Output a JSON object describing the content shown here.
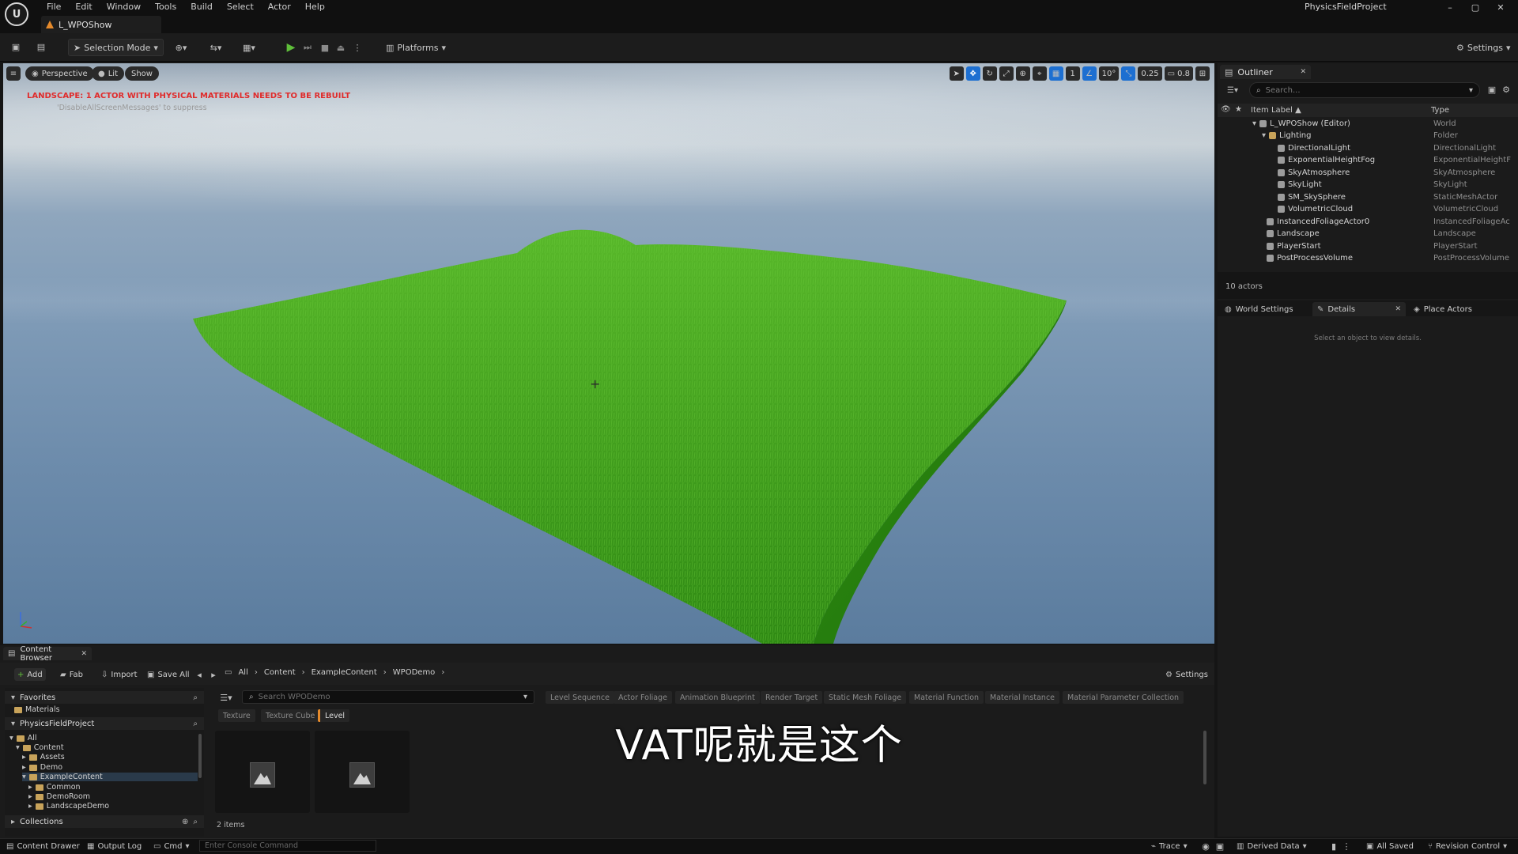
{
  "window": {
    "project_name": "PhysicsFieldProject",
    "level_tab": "L_WPOShow",
    "menu": [
      "File",
      "Edit",
      "Window",
      "Tools",
      "Build",
      "Select",
      "Actor",
      "Help"
    ],
    "controls": [
      "–",
      "▢",
      "✕"
    ]
  },
  "toolbar": {
    "selection_mode": "Selection Mode",
    "platforms": "Platforms",
    "settings": "Settings"
  },
  "viewport": {
    "perspective": "Perspective",
    "lit": "Lit",
    "show": "Show",
    "warning": "LANDSCAPE: 1 ACTOR WITH PHYSICAL MATERIALS NEEDS TO BE REBUILT",
    "suppress_hint": "'DisableAllScreenMessages' to suppress",
    "grid_snap": "1",
    "angle_snap": "10°",
    "scale_snap": "0.25",
    "camera_speed": "0.8"
  },
  "outliner": {
    "tab": "Outliner",
    "search_placeholder": "Search...",
    "col_label": "Item Label ▲",
    "col_type": "Type",
    "rows": [
      {
        "label": "L_WPOShow (Editor)",
        "type": "World"
      },
      {
        "label": "Lighting",
        "type": "Folder"
      },
      {
        "label": "DirectionalLight",
        "type": "DirectionalLight"
      },
      {
        "label": "ExponentialHeightFog",
        "type": "ExponentialHeightF"
      },
      {
        "label": "SkyAtmosphere",
        "type": "SkyAtmosphere"
      },
      {
        "label": "SkyLight",
        "type": "SkyLight"
      },
      {
        "label": "SM_SkySphere",
        "type": "StaticMeshActor"
      },
      {
        "label": "VolumetricCloud",
        "type": "VolumetricCloud"
      },
      {
        "label": "InstancedFoliageActor0",
        "type": "InstancedFoliageAc"
      },
      {
        "label": "Landscape",
        "type": "Landscape"
      },
      {
        "label": "PlayerStart",
        "type": "PlayerStart"
      },
      {
        "label": "PostProcessVolume",
        "type": "PostProcessVolume"
      }
    ],
    "count": "10 actors"
  },
  "details": {
    "tab_world": "World Settings",
    "tab_details": "Details",
    "tab_place": "Place Actors",
    "empty": "Select an object to view details."
  },
  "content_browser": {
    "tab": "Content Browser",
    "add": "Add",
    "fab": "Fab",
    "import": "Import",
    "save_all": "Save All",
    "breadcrumb": [
      "All",
      "Content",
      "ExampleContent",
      "WPODemo"
    ],
    "settings": "Settings",
    "favorites": "Favorites",
    "favorites_items": [
      "Materials"
    ],
    "project": "PhysicsFieldProject",
    "tree": [
      {
        "label": "All",
        "depth": 0
      },
      {
        "label": "Content",
        "depth": 1
      },
      {
        "label": "Assets",
        "depth": 2
      },
      {
        "label": "Demo",
        "depth": 2
      },
      {
        "label": "ExampleContent",
        "depth": 2
      },
      {
        "label": "Common",
        "depth": 3
      },
      {
        "label": "DemoRoom",
        "depth": 3
      },
      {
        "label": "LandscapeDemo",
        "depth": 3
      }
    ],
    "collections": "Collections",
    "search_placeholder": "Search WPODemo",
    "filters": [
      "Level Sequence",
      "Actor Foliage",
      "Animation Blueprint",
      "Render Target",
      "Static Mesh Foliage",
      "Material Function",
      "Material Instance",
      "Material Parameter Collection"
    ],
    "filters2": [
      "Texture",
      "Texture Cube",
      "Level"
    ],
    "items_count": "2 items"
  },
  "subtitle": "VAT呢就是这个",
  "statusbar": {
    "content_drawer": "Content Drawer",
    "output_log": "Output Log",
    "cmd": "Cmd",
    "console_placeholder": "Enter Console Command",
    "trace": "Trace",
    "derived_data": "Derived Data",
    "all_saved": "All Saved",
    "revision_control": "Revision Control"
  },
  "colors": {
    "accent_blue": "#1d6fd1",
    "play_green": "#5fbf3a",
    "warning_red": "#e02b2b",
    "grass_green": "#3f9a1c"
  }
}
